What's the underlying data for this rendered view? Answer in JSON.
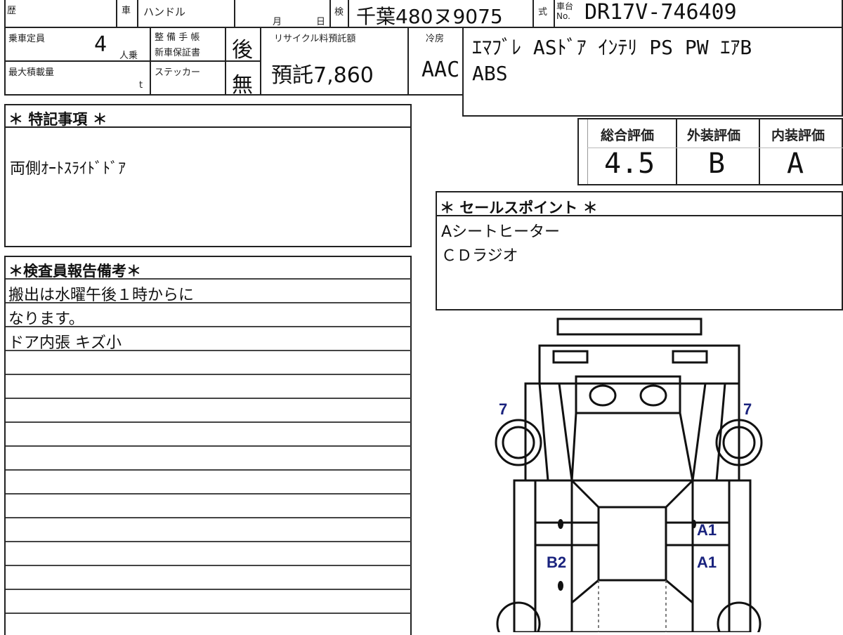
{
  "header": {
    "history_label": "歴",
    "car_label": "車",
    "handle_label": "ハンドル",
    "month_label": "月",
    "day_label": "日",
    "inspection_label": "検",
    "plate": "千葉480ヌ9075",
    "model_label": "式",
    "chassis_label_top": "車台",
    "chassis_label_bottom": "No.",
    "chassis_no": "DR17V-746409"
  },
  "specs": {
    "capacity_label": "乗車定員",
    "capacity_value": "4",
    "capacity_unit": "人乗",
    "load_label": "最大積載量",
    "load_unit": "t",
    "maintenance_label_1": "整 備 手 帳",
    "maintenance_label_2": "新車保証書",
    "maintenance_value": "後",
    "sticker_label": "ステッカー",
    "sticker_value": "無",
    "recycle_label": "リサイクル料預託額",
    "recycle_value": "預託7,860",
    "ac_label": "冷房",
    "ac_value": "AAC",
    "equipment_line_1": "ｴﾏﾌﾞﾚ ASﾄﾞｱ ｲﾝﾃﾘ PS PW ｴｱB",
    "equipment_line_2": "ABS"
  },
  "remarks": {
    "title": "＊ 特記事項 ＊",
    "text": "両側ｵｰﾄｽﾗｲﾄﾞﾄﾞｱ"
  },
  "ratings": {
    "overall_label": "総合評価",
    "overall_value": "4.5",
    "exterior_label": "外装評価",
    "exterior_value": "B",
    "interior_label": "内装評価",
    "interior_value": "A"
  },
  "sales_points": {
    "title": "＊ セールスポイント ＊",
    "items": [
      "Aシートヒーター",
      "ＣＤラジオ"
    ]
  },
  "inspector": {
    "title": "＊検査員報告備考＊",
    "lines": [
      "搬出は水曜午後１時からに",
      "なります。",
      "ドア内張 キズ小"
    ]
  },
  "diagram": {
    "marks": {
      "front_left": "7",
      "front_right": "7",
      "right_door_upper": "A1",
      "right_door_lower": "A1",
      "left_door_lower": "B2"
    }
  }
}
